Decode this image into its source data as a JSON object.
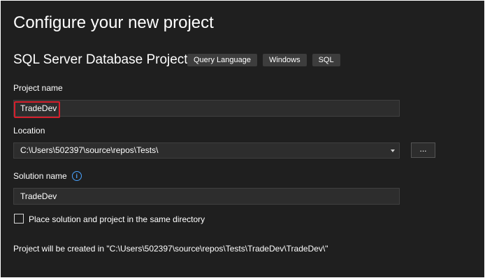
{
  "dialog": {
    "title": "Configure your new project",
    "project_type": "SQL Server Database Project",
    "tags": [
      "Query Language",
      "Windows",
      "SQL"
    ]
  },
  "project_name": {
    "label": "Project name",
    "value": "TradeDev"
  },
  "location": {
    "label": "Location",
    "value": "C:\\Users\\502397\\source\\repos\\Tests\\",
    "browse_label": "..."
  },
  "solution_name": {
    "label": "Solution name",
    "value": "TradeDev",
    "info_icon": "info-icon"
  },
  "same_directory": {
    "label": "Place solution and project in the same directory",
    "checked": false
  },
  "footer": {
    "created_in": "Project will be created in \"C:\\Users\\502397\\source\\repos\\Tests\\TradeDev\\TradeDev\\\""
  },
  "colors": {
    "background": "#1f1f1f",
    "input_background": "#2d2d2d",
    "tag_background": "#3d3d3d",
    "highlight": "#d61f2c",
    "info_accent": "#4aa3ff"
  }
}
